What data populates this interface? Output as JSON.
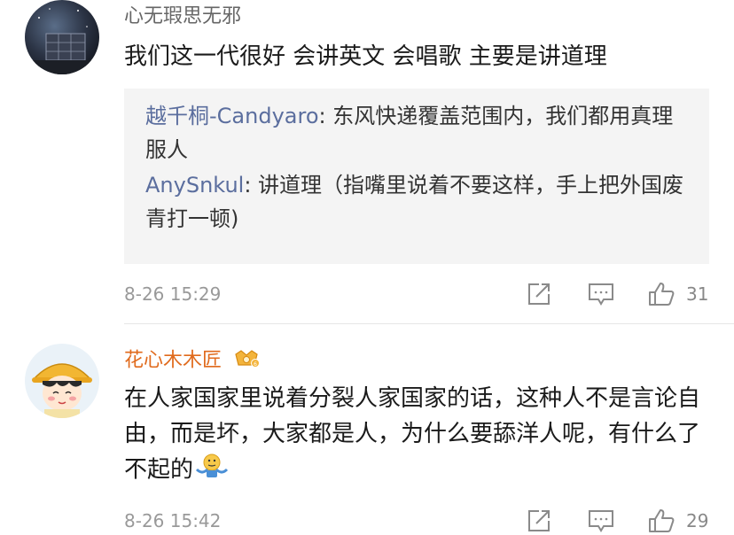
{
  "comments": [
    {
      "username": "心无瑕思无邪",
      "content": "我们这一代很好 会讲英文 会唱歌 主要是讲道理",
      "replies": [
        {
          "user": "越千桐-Candyaro",
          "text": ": 东风快递覆盖范围内，我们都用真理服人"
        },
        {
          "user": "AnySnkul",
          "text": ": 讲道理（指嘴里说着不要这样，手上把外国废青打一顿)"
        }
      ],
      "timestamp": "8-26 15:29",
      "likes": "31"
    },
    {
      "username": "花心木木匠",
      "content": "在人家国家里说着分裂人家国家的话，这种人不是言论自由，而是坏，大家都是人，为什么要舔洋人呢，有什么了不起的",
      "timestamp": "8-26 15:42",
      "likes": "29"
    }
  ],
  "colors": {
    "username": "#666666",
    "username_vip": "#e06a1c",
    "reply_user": "#5b6e9e",
    "meta": "#999999",
    "reply_bg": "#f4f4f4"
  },
  "icons": [
    "share-icon",
    "comment-icon",
    "like-icon",
    "vip-badge-icon",
    "shrug-emoji-icon"
  ]
}
